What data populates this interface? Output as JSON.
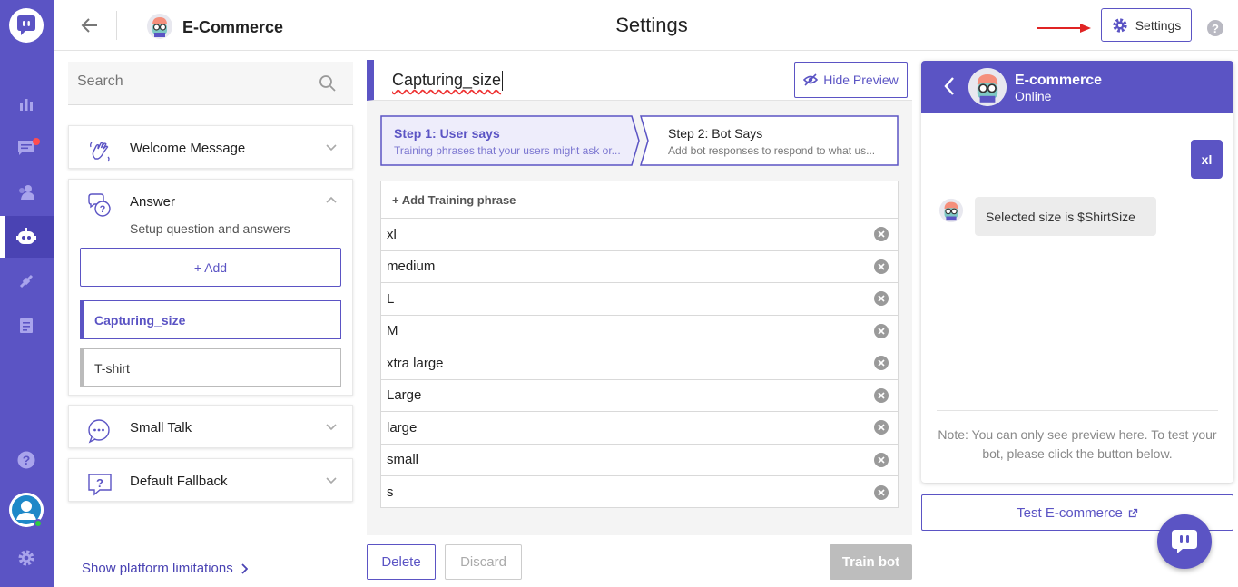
{
  "header": {
    "bot_name": "E-Commerce",
    "page_title": "Settings",
    "settings_label": "Settings",
    "help_glyph": "?"
  },
  "sidebar": {
    "search_placeholder": "Search",
    "sections": {
      "welcome": "Welcome Message",
      "answer": "Answer",
      "answer_desc": "Setup question and answers",
      "add_label": "+ Add",
      "small_talk": "Small Talk",
      "fallback": "Default Fallback"
    },
    "intents": [
      "Capturing_size",
      "T-shirt"
    ],
    "show_limits": "Show platform limitations"
  },
  "editor": {
    "intent_name": "Capturing_size",
    "hide_preview": "Hide Preview",
    "step1_title": "Step 1: User says",
    "step1_sub": "Training phrases that your users might ask or...",
    "step2_title": "Step 2: Bot Says",
    "step2_sub": "Add bot responses to respond to what us...",
    "add_phrase": "+ Add Training phrase",
    "phrases": [
      "xl",
      "medium",
      "L",
      "M",
      "xtra large",
      "Large",
      "large",
      "small",
      "s"
    ],
    "delete": "Delete",
    "discard": "Discard",
    "train": "Train bot"
  },
  "preview": {
    "name": "E-commerce",
    "status": "Online",
    "user_msg": "xl",
    "bot_msg": "Selected size is $ShirtSize",
    "note": "Note: You can only see preview here. To test your bot, please click the button below.",
    "test_button": "Test E-commerce"
  },
  "colors": {
    "brand": "#5b54c4",
    "danger": "#e02424"
  },
  "icons": {
    "rail": [
      "chat-logo-icon",
      "analytics-icon",
      "conversations-icon",
      "users-icon",
      "bot-icon",
      "integrations-icon",
      "docs-icon",
      "help-icon",
      "settings-gear-icon"
    ]
  }
}
